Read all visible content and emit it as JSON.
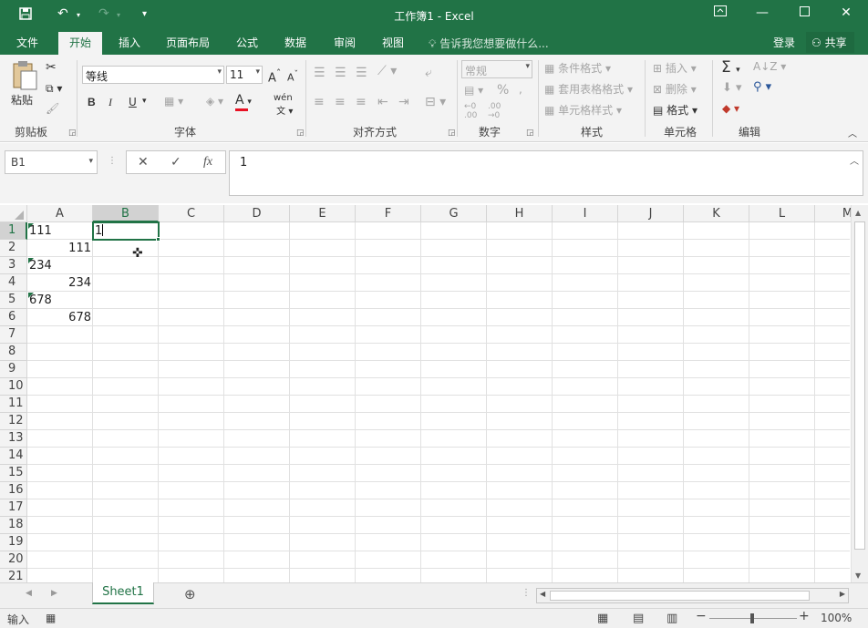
{
  "titlebar": {
    "title": "工作簿1 - Excel",
    "save_icon": "save-icon",
    "undo_icon": "undo-icon",
    "redo_icon": "redo-icon",
    "customize_icon": "customize-qat-icon",
    "restore_ribbon_icon": "ribbon-display-icon",
    "minimize_icon": "minimize-icon",
    "maximize_icon": "maximize-icon",
    "close_icon": "close-icon"
  },
  "tabs": [
    "文件",
    "开始",
    "插入",
    "页面布局",
    "公式",
    "数据",
    "审阅",
    "视图"
  ],
  "active_tab": "开始",
  "tell_me": "告诉我您想要做什么...",
  "login": "登录",
  "share": "共享",
  "ribbon": {
    "clipboard": {
      "label": "剪贴板",
      "paste": "粘贴"
    },
    "font": {
      "label": "字体",
      "name": "等线",
      "size": "11",
      "bold": "B",
      "italic": "I",
      "underline": "U",
      "font_color": "#e81123"
    },
    "alignment": {
      "label": "对齐方式"
    },
    "number": {
      "label": "数字",
      "format": "常规",
      "percent": "%"
    },
    "styles": {
      "label": "样式",
      "conditional": "条件格式",
      "table": "套用表格格式",
      "cell_styles": "单元格样式"
    },
    "cells": {
      "label": "单元格",
      "insert": "插入",
      "delete": "删除",
      "format": "格式"
    },
    "editing": {
      "label": "编辑"
    }
  },
  "formula_bar": {
    "name_box": "B1",
    "cancel": "✕",
    "enter": "✓",
    "fx": "fx",
    "value": "1"
  },
  "columns": [
    "A",
    "B",
    "C",
    "D",
    "E",
    "F",
    "G",
    "H",
    "I",
    "J",
    "K",
    "L",
    "M"
  ],
  "rows": [
    "1",
    "2",
    "3",
    "4",
    "5",
    "6",
    "7",
    "8",
    "9",
    "10",
    "11",
    "12",
    "13",
    "14",
    "15",
    "16",
    "17",
    "18",
    "19",
    "20",
    "21"
  ],
  "cells": {
    "A1": "111",
    "A2": "111",
    "A3": "234",
    "A4": "234",
    "A5": "678",
    "A6": "678",
    "B1": "1"
  },
  "selected_cell": "B1",
  "sheets": [
    "Sheet1"
  ],
  "status": {
    "mode": "输入",
    "zoom": "100%"
  },
  "colors": {
    "accent": "#217346",
    "ribbon_bg": "#f3f3f3"
  }
}
